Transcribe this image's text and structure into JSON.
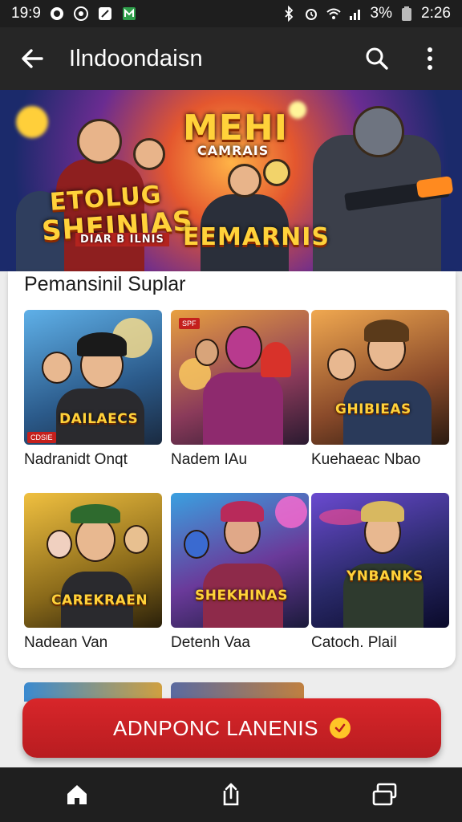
{
  "status_bar": {
    "time_left": "19:9",
    "battery": "3%",
    "clock": "2:26",
    "left_icons": [
      "gallery-icon",
      "settings-icon",
      "compass-icon",
      "app-m-icon"
    ],
    "right_icons": [
      "bluetooth-icon",
      "alarm-icon",
      "wifi-icon",
      "signal-icon",
      "battery-icon"
    ]
  },
  "app_bar": {
    "title": "Ilndoondaisn",
    "back_icon": "arrow-back-icon",
    "search_icon": "search-icon",
    "menu_icon": "more-vert-icon"
  },
  "banner": {
    "left_title_1": "ETOLUG",
    "left_title_2": "SHEINIAS",
    "left_subtitle": "DIAR B ILNIS",
    "center_title": "MEHI",
    "center_subtitle": "CAMRAIS",
    "center_bottom": "EEMARNIS"
  },
  "section": {
    "title": "Pemansinil Suplar"
  },
  "tiles": [
    {
      "label": "Nadranidt Onqt",
      "art_text": "DAILAECS",
      "badge": "CDSIE"
    },
    {
      "label": "Nadem IAu",
      "art_text": "",
      "badge": "SPF"
    },
    {
      "label": "Kuehaeac Nbao",
      "art_text": "GHIBIEAS",
      "badge": ""
    },
    {
      "label": "Nadean Van",
      "art_text": "CAREKRAEN",
      "badge": ""
    },
    {
      "label": "Detenh Vaa",
      "art_text": "SHEKHINAS",
      "badge": ""
    },
    {
      "label": "Catoch. Plail",
      "art_text": "YNBANKS",
      "badge": ""
    }
  ],
  "cta": {
    "label": "ADNPONC LANENIS",
    "icon": "check-circle-icon",
    "color": "#c92024"
  },
  "nav_bar": {
    "items": [
      "home-icon",
      "share-icon",
      "recent-apps-icon"
    ]
  }
}
